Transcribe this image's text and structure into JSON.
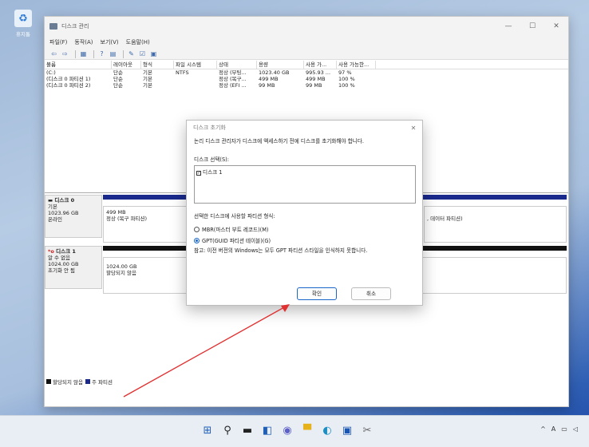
{
  "desktop": {
    "icon_label": "휴지통"
  },
  "window": {
    "title": "디스크 관리",
    "min": "—",
    "max": "☐",
    "close": "✕"
  },
  "menu": [
    "파일(F)",
    "동작(A)",
    "보기(V)",
    "도움말(H)"
  ],
  "volume_table": {
    "headers": [
      "볼륨",
      "레이아웃",
      "형식",
      "파일 시스템",
      "상태",
      "용량",
      "사용 가...",
      "사용 가능한..."
    ],
    "rows": [
      [
        "(C:)",
        "단순",
        "기본",
        "NTFS",
        "정상 (부팅...",
        "1023.40 GB",
        "995.93 ...",
        "97 %"
      ],
      [
        "(디스크 0 파티션 1)",
        "단순",
        "기본",
        "",
        "정상 (복구...",
        "499 MB",
        "499 MB",
        "100 %"
      ],
      [
        "(디스크 0 파티션 2)",
        "단순",
        "기본",
        "",
        "정상 (EFI ...",
        "99 MB",
        "99 MB",
        "100 %"
      ]
    ]
  },
  "disks": [
    {
      "name": "디스크 0",
      "lines": [
        "기본",
        "1023.96 GB",
        "온라인"
      ],
      "part_size": "499 MB",
      "part_status": "정상 (복구 파티션)",
      "right_text": "데이터 파티션)",
      "bar_color": "#1a2a8c"
    },
    {
      "name": "디스크 1",
      "lines": [
        "알 수 없음",
        "1024.00 GB",
        "초기화 안 됨"
      ],
      "part_size": "1024.00 GB",
      "part_status": "할당되지 않음",
      "right_text": "",
      "bar_color": "#111111"
    }
  ],
  "legend": {
    "unallocated": "할당되지 않음",
    "primary": "주 파티션"
  },
  "dialog": {
    "title": "디스크 초기화",
    "message": "논리 디스크 관리자가 디스크에 액세스하기 전에 디스크를 초기화해야 합니다.",
    "select_label": "디스크 선택(S):",
    "disk_item": "디스크 1",
    "style_label": "선택한 디스크에 사용할 파티션 형식:",
    "mbr": "MBR(마스터 부트 레코드)(M)",
    "gpt": "GPT(GUID 파티션 테이블)(G)",
    "note": "참고: 이전 버전의 Windows는 모두 GPT 파티션 스타일을 인식하지 못합니다.",
    "ok": "확인",
    "cancel": "취소"
  },
  "tray": {
    "chevron": "^",
    "lang": "A"
  }
}
